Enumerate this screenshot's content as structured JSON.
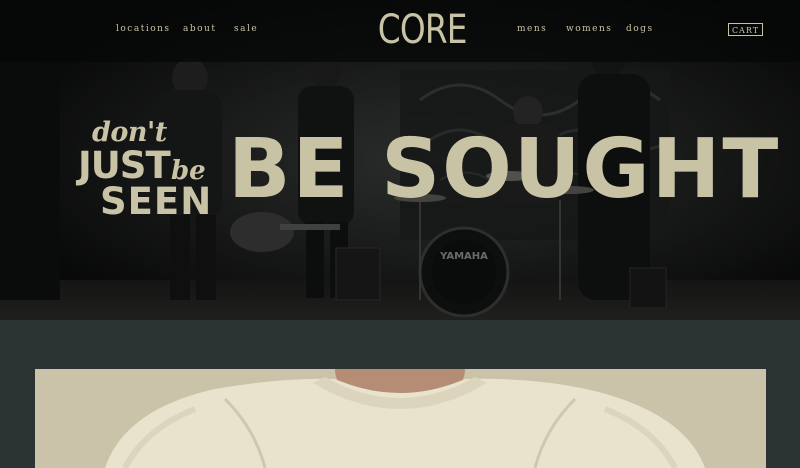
{
  "nav": {
    "left_links": [
      {
        "label": "locations"
      },
      {
        "label": "about"
      },
      {
        "label": "sale"
      }
    ],
    "right_links": [
      {
        "label": "mens"
      },
      {
        "label": "womens"
      },
      {
        "label": "dogs"
      }
    ],
    "logo": "CORE",
    "cart_label": "CART"
  },
  "hero": {
    "headline_dont": "don't",
    "headline_just": "JUST",
    "headline_be_small": "be",
    "headline_seen": "SEEN",
    "headline_big": "BE SOUGHT",
    "drum_brand": "YAMAHA"
  },
  "colors": {
    "text_accent": "#c9c3a6",
    "section_background": "#2c3433",
    "hero_background": "#0b0c0c"
  }
}
